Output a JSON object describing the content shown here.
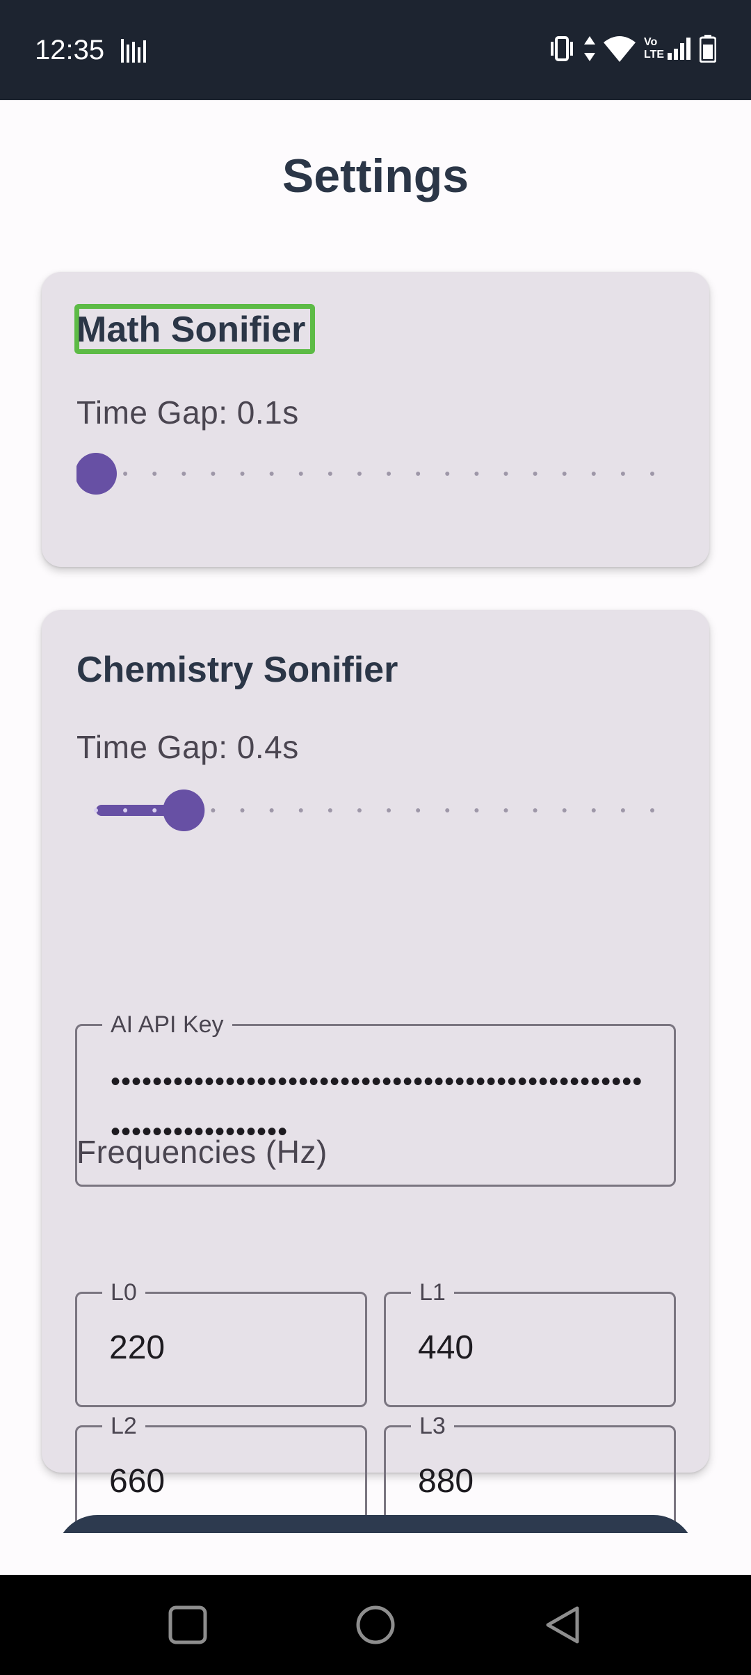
{
  "status_bar": {
    "time": "12:35",
    "icons": [
      "signal-bars-icon",
      "vibrate-icon",
      "data-arrows-icon",
      "wifi-icon",
      "volte-icon",
      "cell-signal-icon",
      "battery-icon"
    ],
    "volte_text": "Vo LTE"
  },
  "page": {
    "title": "Settings"
  },
  "math_sonifier": {
    "title": "Math Sonifier",
    "time_gap_label": "Time Gap: 0.1s",
    "slider_value": 0.1,
    "slider_min": 0.1,
    "slider_max": 2.0,
    "slider_step": 0.1
  },
  "chemistry_sonifier": {
    "title": "Chemistry Sonifier",
    "time_gap_label": "Time Gap: 0.4s",
    "slider_value": 0.4,
    "slider_min": 0.1,
    "slider_max": 2.0,
    "slider_step": 0.1,
    "api_key": {
      "label": "AI API Key",
      "masked_value": "••••••••••••••••••••••••••••••••••••••••••••••••••••••••••••••••••••"
    },
    "frequencies": {
      "label": "Frequencies (Hz)",
      "fields": [
        {
          "label": "L0",
          "value": "220"
        },
        {
          "label": "L1",
          "value": "440"
        },
        {
          "label": "L2",
          "value": "660"
        },
        {
          "label": "L3",
          "value": "880"
        }
      ]
    }
  },
  "colors": {
    "accent": "#6750a4",
    "focus_ring": "#5dbb46",
    "card_bg": "#e6e1e8",
    "title_text": "#2b3647",
    "status_bar_bg": "#1d2430"
  },
  "nav_bar": {
    "icons": [
      "recents-square-icon",
      "home-circle-icon",
      "back-triangle-icon"
    ]
  }
}
